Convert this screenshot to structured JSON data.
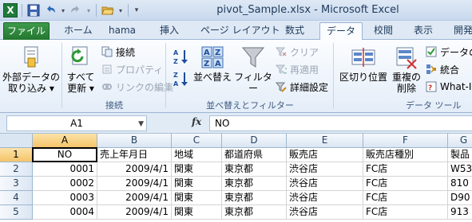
{
  "window": {
    "title": "pivot_Sample.xlsx - Microsoft Excel",
    "app_icon_label": "X"
  },
  "tabs": [
    {
      "label": "ファイル"
    },
    {
      "label": "ホーム"
    },
    {
      "label": "hama"
    },
    {
      "label": "挿入"
    },
    {
      "label": "ページ レイアウト"
    },
    {
      "label": "数式"
    },
    {
      "label": "データ"
    },
    {
      "label": "校閲"
    },
    {
      "label": "表示"
    },
    {
      "label": "開発"
    }
  ],
  "ribbon": {
    "external": {
      "label_line1": "外部データの",
      "label_line2": "取り込み ▾"
    },
    "connections": {
      "refresh_line1": "すべて",
      "refresh_line2": "更新 ▾",
      "connect": "接続",
      "properties": "プロパティ",
      "edit_links": "リンクの編集",
      "group": "接続"
    },
    "sort_filter": {
      "sort_label": "並べ替え",
      "filter_label": "フィルター",
      "clear": "クリア",
      "reapply": "再適用",
      "advanced": "詳細設定",
      "group": "並べ替えとフィルター"
    },
    "data_tools": {
      "text_to_columns": "区切り位置",
      "remove_dup_line1": "重複の",
      "remove_dup_line2": "削除",
      "validation": "データの入",
      "consolidate": "統合",
      "whatif": "What-I",
      "group": "データ ツール"
    }
  },
  "formula_bar": {
    "name_box": "A1",
    "fx": "fx",
    "content": "NO"
  },
  "grid": {
    "columns": [
      "A",
      "B",
      "C",
      "D",
      "E",
      "F",
      "G"
    ],
    "row_numbers": [
      "1",
      "2",
      "3",
      "4",
      "5"
    ],
    "rows": [
      [
        "NO",
        "売上年月日",
        "地域",
        "都道府県",
        "販売店",
        "販売店種別",
        "製品"
      ],
      [
        "0001",
        "2009/4/1",
        "関東",
        "東京都",
        "渋谷店",
        "FC店",
        "W53"
      ],
      [
        "0002",
        "2009/4/1",
        "関東",
        "東京都",
        "渋谷店",
        "FC店",
        "810"
      ],
      [
        "0003",
        "2009/4/1",
        "関東",
        "東京都",
        "渋谷店",
        "FC店",
        "D90"
      ],
      [
        "0004",
        "2009/4/1",
        "関東",
        "東京都",
        "渋谷店",
        "FC店",
        "913"
      ]
    ]
  },
  "colors": {
    "file_tab": "#22772f",
    "selection": "#f5c46a"
  }
}
